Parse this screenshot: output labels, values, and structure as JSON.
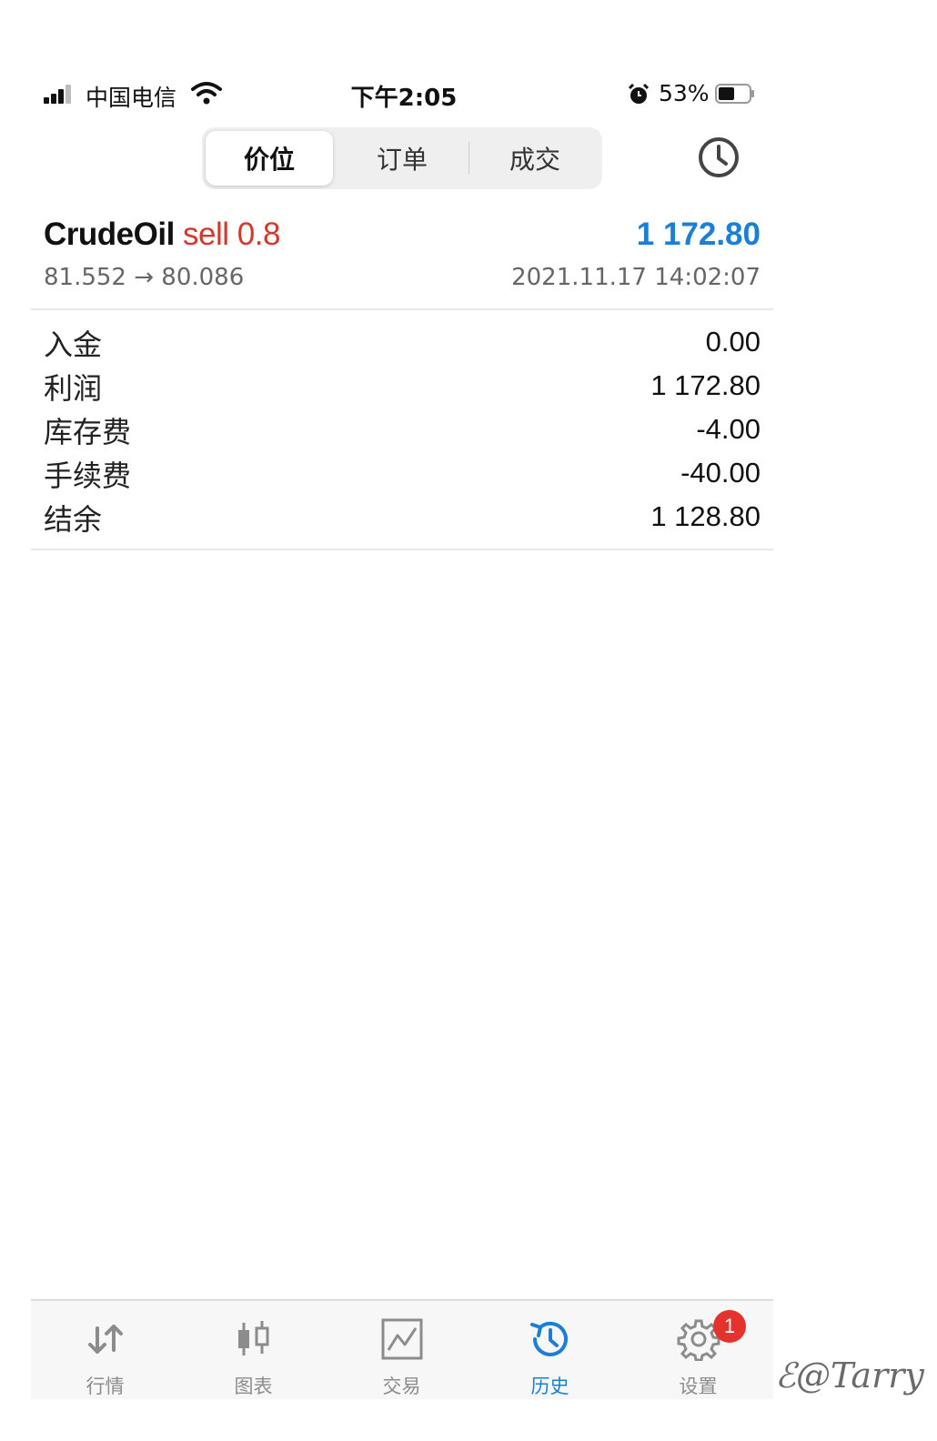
{
  "status_bar": {
    "carrier": "中国电信",
    "time": "下午2:05",
    "battery_percent": "53%",
    "battery_level": 0.53
  },
  "segments": [
    {
      "label": "价位",
      "active": true
    },
    {
      "label": "订单",
      "active": false
    },
    {
      "label": "成交",
      "active": false
    }
  ],
  "trade": {
    "symbol": "CrudeOil",
    "side": "sell 0.8",
    "profit": "1 172.80",
    "prices": "81.552 → 80.086",
    "time": "2021.11.17 14:02:07"
  },
  "summary": [
    {
      "label": "入金",
      "value": "0.00"
    },
    {
      "label": "利润",
      "value": "1 172.80"
    },
    {
      "label": "库存费",
      "value": "-4.00"
    },
    {
      "label": "手续费",
      "value": "-40.00"
    },
    {
      "label": "结余",
      "value": "1 128.80"
    }
  ],
  "tabs": [
    {
      "label": "行情",
      "icon": "quotes-arrows-icon",
      "active": false
    },
    {
      "label": "图表",
      "icon": "candlestick-chart-icon",
      "active": false
    },
    {
      "label": "交易",
      "icon": "trade-line-chart-icon",
      "active": false
    },
    {
      "label": "历史",
      "icon": "history-clock-icon",
      "active": true
    },
    {
      "label": "设置",
      "icon": "gear-icon",
      "active": false,
      "badge": "1"
    }
  ],
  "watermark": "@Tarry",
  "colors": {
    "accent_blue": "#1b7fd8",
    "sell_red": "#d0392b",
    "badge_red": "#e5322d",
    "inactive_gray": "#8c8c8c"
  }
}
